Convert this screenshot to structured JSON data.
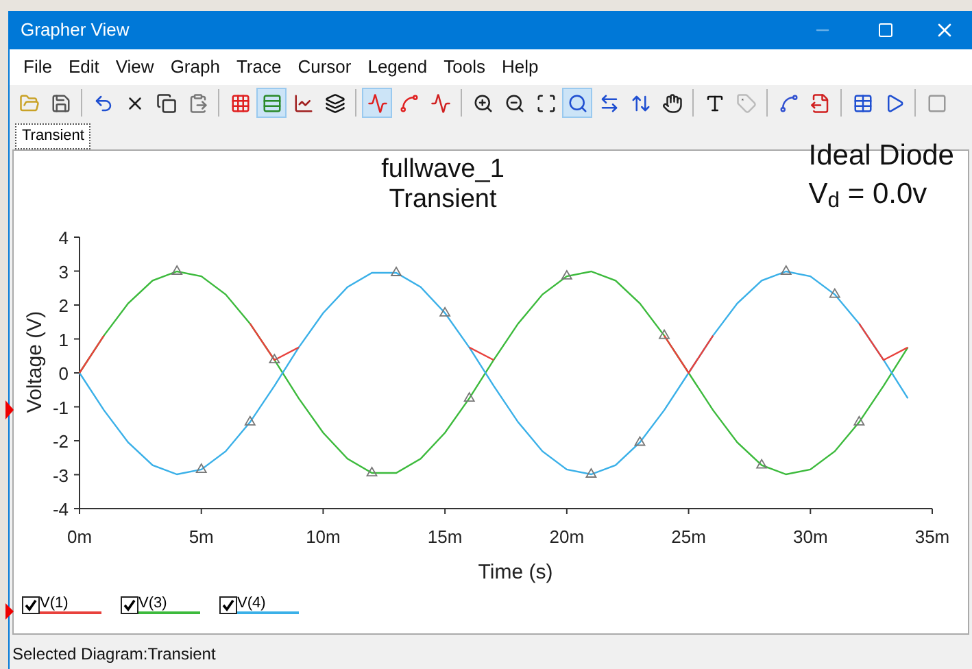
{
  "window": {
    "title": "Grapher View"
  },
  "menu": [
    "File",
    "Edit",
    "View",
    "Graph",
    "Trace",
    "Cursor",
    "Legend",
    "Tools",
    "Help"
  ],
  "toolbar": [
    {
      "kind": "open",
      "pressed": false
    },
    {
      "kind": "save",
      "pressed": false
    },
    {
      "kind": "sep"
    },
    {
      "kind": "undo",
      "pressed": false
    },
    {
      "kind": "delete",
      "pressed": false
    },
    {
      "kind": "copy",
      "pressed": false
    },
    {
      "kind": "paste",
      "pressed": false
    },
    {
      "kind": "sep"
    },
    {
      "kind": "grid",
      "pressed": false
    },
    {
      "kind": "colors",
      "pressed": true
    },
    {
      "kind": "traces",
      "pressed": false
    },
    {
      "kind": "overlay",
      "pressed": false
    },
    {
      "kind": "sep"
    },
    {
      "kind": "lines",
      "pressed": true
    },
    {
      "kind": "points",
      "pressed": false
    },
    {
      "kind": "linepoints",
      "pressed": false
    },
    {
      "kind": "sep"
    },
    {
      "kind": "zoomin",
      "pressed": false
    },
    {
      "kind": "zoomout",
      "pressed": false
    },
    {
      "kind": "zoomfit",
      "pressed": false
    },
    {
      "kind": "zoomarea",
      "pressed": true
    },
    {
      "kind": "zoomx",
      "pressed": false
    },
    {
      "kind": "zoomy",
      "pressed": false
    },
    {
      "kind": "pan",
      "pressed": false
    },
    {
      "kind": "sep"
    },
    {
      "kind": "text",
      "pressed": false
    },
    {
      "kind": "label",
      "pressed": false
    },
    {
      "kind": "sep"
    },
    {
      "kind": "cursors",
      "pressed": false
    },
    {
      "kind": "export",
      "pressed": false
    },
    {
      "kind": "sep"
    },
    {
      "kind": "table",
      "pressed": false
    },
    {
      "kind": "run",
      "pressed": false
    },
    {
      "kind": "sep"
    },
    {
      "kind": "stop",
      "pressed": false
    }
  ],
  "tabs": [
    {
      "label": "Transient",
      "selected": true
    }
  ],
  "graph": {
    "title": "fullwave_1",
    "subtitle": "Transient",
    "annotation": [
      "Ideal Diode",
      "V$_{d}$ = 0.0v"
    ],
    "chart_data": {
      "type": "line",
      "xlabel": "Time (s)",
      "ylabel": "Voltage (V)",
      "x": [
        0,
        1,
        2,
        3,
        4,
        5,
        6,
        7,
        8,
        9,
        10,
        11,
        12,
        13,
        14,
        15,
        16,
        17,
        18,
        19,
        20,
        21,
        22,
        23,
        24,
        25,
        26,
        27,
        28,
        29,
        30,
        31,
        32,
        33,
        34
      ],
      "series": [
        {
          "name": "V(1)",
          "color": "#e8413c",
          "values": [
            0,
            1.1,
            null,
            null,
            null,
            null,
            null,
            1.45,
            0.38,
            0.75,
            null,
            null,
            null,
            null,
            null,
            null,
            0.75,
            0.38,
            null,
            null,
            null,
            null,
            null,
            null,
            1.1,
            0,
            1.1,
            null,
            null,
            null,
            null,
            null,
            1.45,
            0.38,
            0.75
          ]
        },
        {
          "name": "V(3)",
          "color": "#3cba3c",
          "values": [
            0,
            1.1,
            2.05,
            2.72,
            2.99,
            2.85,
            2.31,
            1.45,
            0.38,
            -0.75,
            -1.76,
            -2.53,
            -2.95,
            -2.95,
            -2.53,
            -1.76,
            -0.75,
            0.38,
            1.45,
            2.31,
            2.85,
            2.99,
            2.72,
            2.05,
            1.1,
            0,
            -1.1,
            -2.05,
            -2.72,
            -2.99,
            -2.85,
            -2.31,
            -1.45,
            -0.38,
            0.75
          ]
        },
        {
          "name": "V(4)",
          "color": "#3ab0e8",
          "values": [
            0,
            -1.1,
            -2.05,
            -2.72,
            -2.99,
            -2.85,
            -2.31,
            -1.45,
            -0.38,
            0.75,
            1.76,
            2.53,
            2.95,
            2.95,
            2.53,
            1.76,
            0.75,
            -0.38,
            -1.45,
            -2.31,
            -2.85,
            -2.99,
            -2.72,
            -2.05,
            -1.1,
            0,
            1.1,
            2.05,
            2.72,
            2.99,
            2.85,
            2.31,
            1.45,
            0.38,
            -0.75
          ]
        }
      ],
      "xlim": [
        0,
        35
      ],
      "ylim": [
        -4,
        4
      ],
      "xticks": [
        {
          "value": 0,
          "label": "0m"
        },
        {
          "value": 5,
          "label": "5m"
        },
        {
          "value": 10,
          "label": "10m"
        },
        {
          "value": 15,
          "label": "15m"
        },
        {
          "value": 20,
          "label": "20m"
        },
        {
          "value": 25,
          "label": "25m"
        },
        {
          "value": 30,
          "label": "30m"
        },
        {
          "value": 35,
          "label": "35m"
        }
      ],
      "yticks": [
        -4,
        -3,
        -2,
        -1,
        0,
        1,
        2,
        3,
        4
      ]
    }
  },
  "legend": [
    {
      "checked": true
    },
    {
      "checked": true
    },
    {
      "checked": true
    }
  ],
  "status_bar": "Selected Diagram:Transient"
}
